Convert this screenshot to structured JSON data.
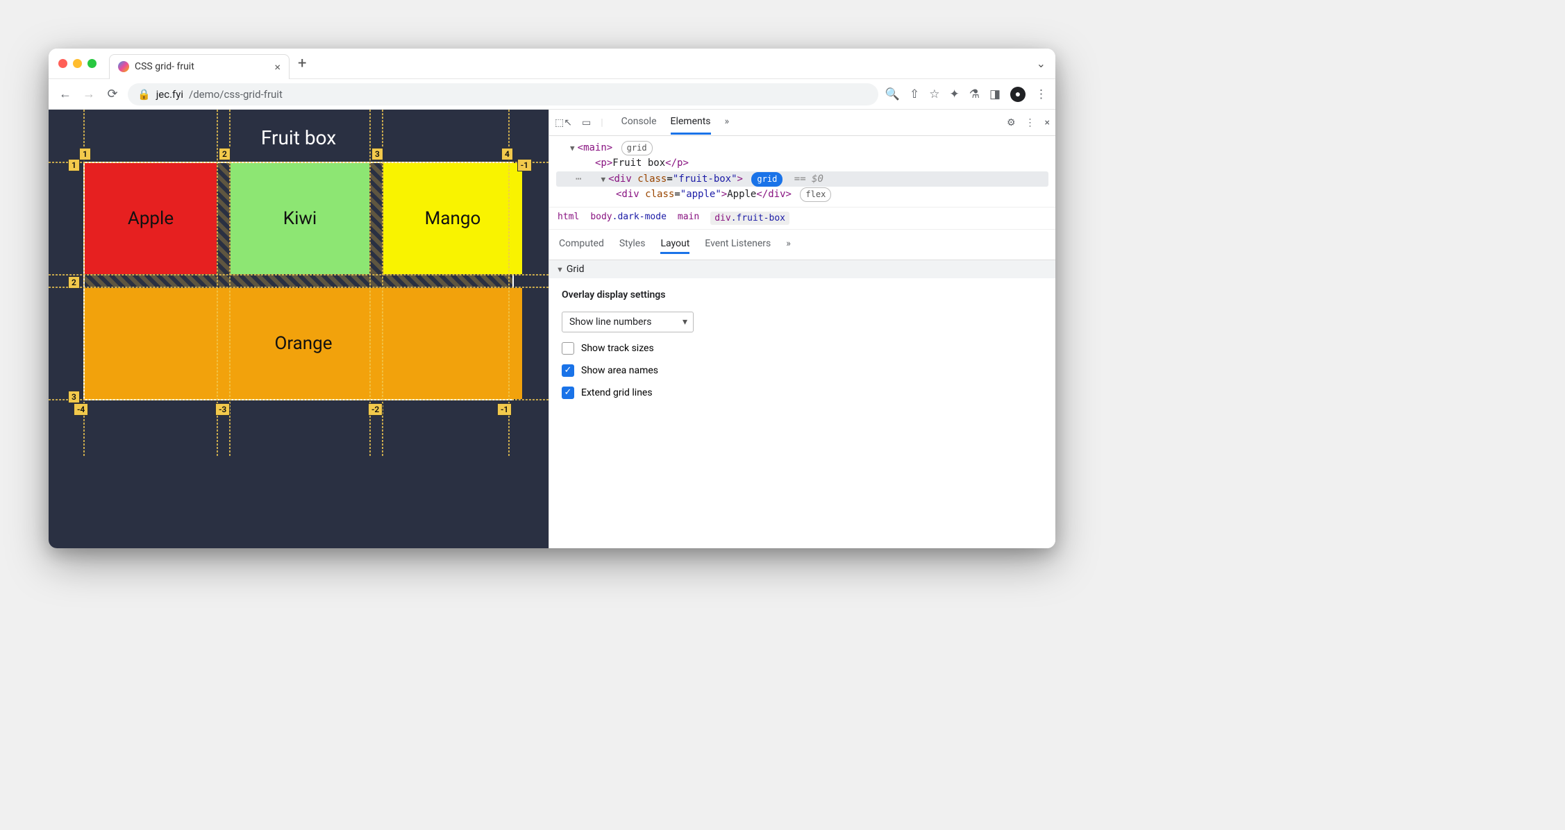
{
  "tab": {
    "title": "CSS grid- fruit"
  },
  "url": {
    "host": "jec.fyi",
    "path": "/demo/css-grid-fruit"
  },
  "page": {
    "title": "Fruit box",
    "cells": {
      "apple": "Apple",
      "kiwi": "Kiwi",
      "mango": "Mango",
      "orange": "Orange"
    },
    "line_numbers": {
      "top": [
        "1",
        "2",
        "3",
        "4"
      ],
      "left": [
        "1",
        "2",
        "3"
      ],
      "right_neg": "-1",
      "bottom_neg": [
        "-4",
        "-3",
        "-2",
        "-1"
      ]
    }
  },
  "devtools": {
    "tabs": {
      "console": "Console",
      "elements": "Elements",
      "more": "»"
    },
    "dom": {
      "main": "main",
      "grid_pill": "grid",
      "p_text": "Fruit box",
      "div_class": "fruit-box",
      "grid_pill_active": "grid",
      "eq": "== $0",
      "child_class": "apple",
      "child_text": "Apple",
      "flex_pill": "flex"
    },
    "breadcrumbs": [
      "html",
      "body.dark-mode",
      "main",
      "div.fruit-box"
    ],
    "subtabs": {
      "computed": "Computed",
      "styles": "Styles",
      "layout": "Layout",
      "listeners": "Event Listeners",
      "more": "»"
    },
    "grid_section": "Grid",
    "layout": {
      "heading": "Overlay display settings",
      "select": "Show line numbers",
      "cb_track": "Show track sizes",
      "cb_area": "Show area names",
      "cb_extend": "Extend grid lines"
    }
  }
}
